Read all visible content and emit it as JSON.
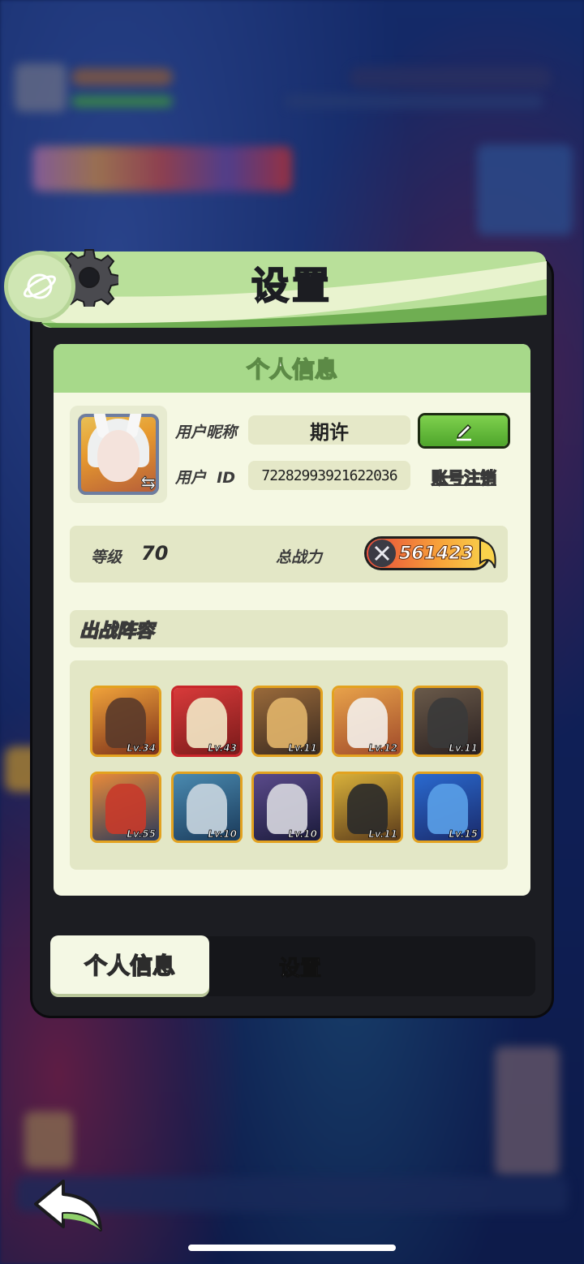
{
  "dialog": {
    "title": "设置",
    "section_title": "个人信息",
    "nickname_label": "用户昵称",
    "nickname_value": "期许",
    "uid_label": "用户  ID",
    "uid_value": "72282993921622036",
    "deregister_label": "账号注销",
    "level_label": "等级",
    "level_value": "70",
    "power_label": "总战力",
    "power_value": "561423",
    "lineup_title": "出战阵容"
  },
  "heroes": [
    {
      "level": "Lv.34",
      "frame": "gold"
    },
    {
      "level": "Lv.43",
      "frame": "red"
    },
    {
      "level": "Lv.11",
      "frame": "gold"
    },
    {
      "level": "Lv.12",
      "frame": "gold"
    },
    {
      "level": "Lv.11",
      "frame": "gold"
    },
    {
      "level": "Lv.55",
      "frame": "gold"
    },
    {
      "level": "Lv.10",
      "frame": "gold"
    },
    {
      "level": "Lv.10",
      "frame": "gold"
    },
    {
      "level": "Lv.11",
      "frame": "gold"
    },
    {
      "level": "Lv.15",
      "frame": "gold"
    }
  ],
  "tabs": {
    "active": "个人信息",
    "inactive": "设置"
  },
  "colors": {
    "accent_green": "#a7d98a",
    "frame_gold": "#e3a21f",
    "frame_red": "#c8262a"
  }
}
